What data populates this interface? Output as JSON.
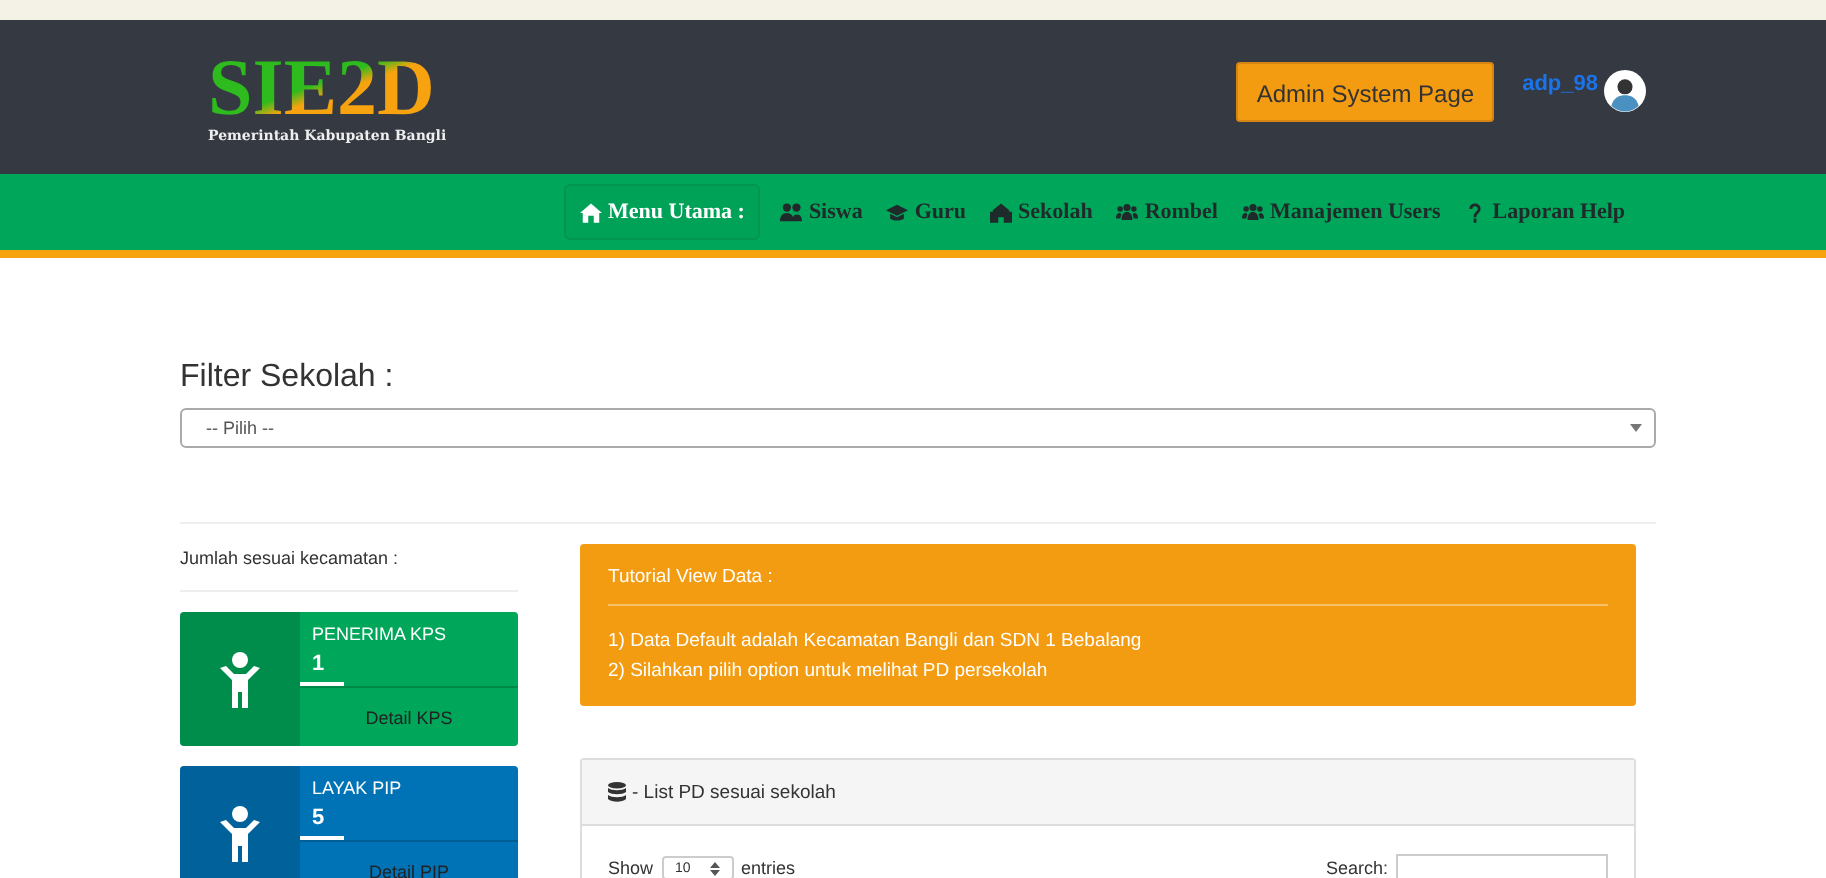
{
  "header": {
    "logo": "SIE2D",
    "subtitle": "Pemerintah Kabupaten Bangli",
    "admin_button": "Admin System Page",
    "username": "adp_98"
  },
  "nav": [
    {
      "label": "Menu Utama :",
      "kind": "heading"
    },
    {
      "label": "Siswa",
      "kind": "link"
    },
    {
      "label": "Guru",
      "kind": "link"
    },
    {
      "label": "Sekolah",
      "kind": "link"
    },
    {
      "label": "Rombel",
      "kind": "link"
    },
    {
      "label": "Manajemen Users",
      "kind": "link"
    },
    {
      "label": "Laporan Help",
      "kind": "link"
    }
  ],
  "filter": {
    "title": "Filter Sekolah :",
    "select_value": "-- Pilih --"
  },
  "stats": {
    "title": "Jumlah sesuai kecamatan :",
    "cards": [
      {
        "label": "PENERIMA KPS",
        "value": "1",
        "link": "Detail KPS",
        "color": "#00a65a"
      },
      {
        "label": "LAYAK PIP",
        "value": "5",
        "link": "Detail PIP",
        "color": "#0073b7"
      }
    ]
  },
  "tutorial": {
    "title": "Tutorial View Data :",
    "lines": [
      "1) Data Default adalah Kecamatan Bangli dan SDN 1 Bebalang",
      "2) Silahkan pilih option untuk melihat PD persekolah"
    ]
  },
  "list_panel": {
    "title": "- List PD sesuai sekolah",
    "show_label": "Show",
    "page_size": "10",
    "entries_label": "entries",
    "search_label": "Search:"
  }
}
